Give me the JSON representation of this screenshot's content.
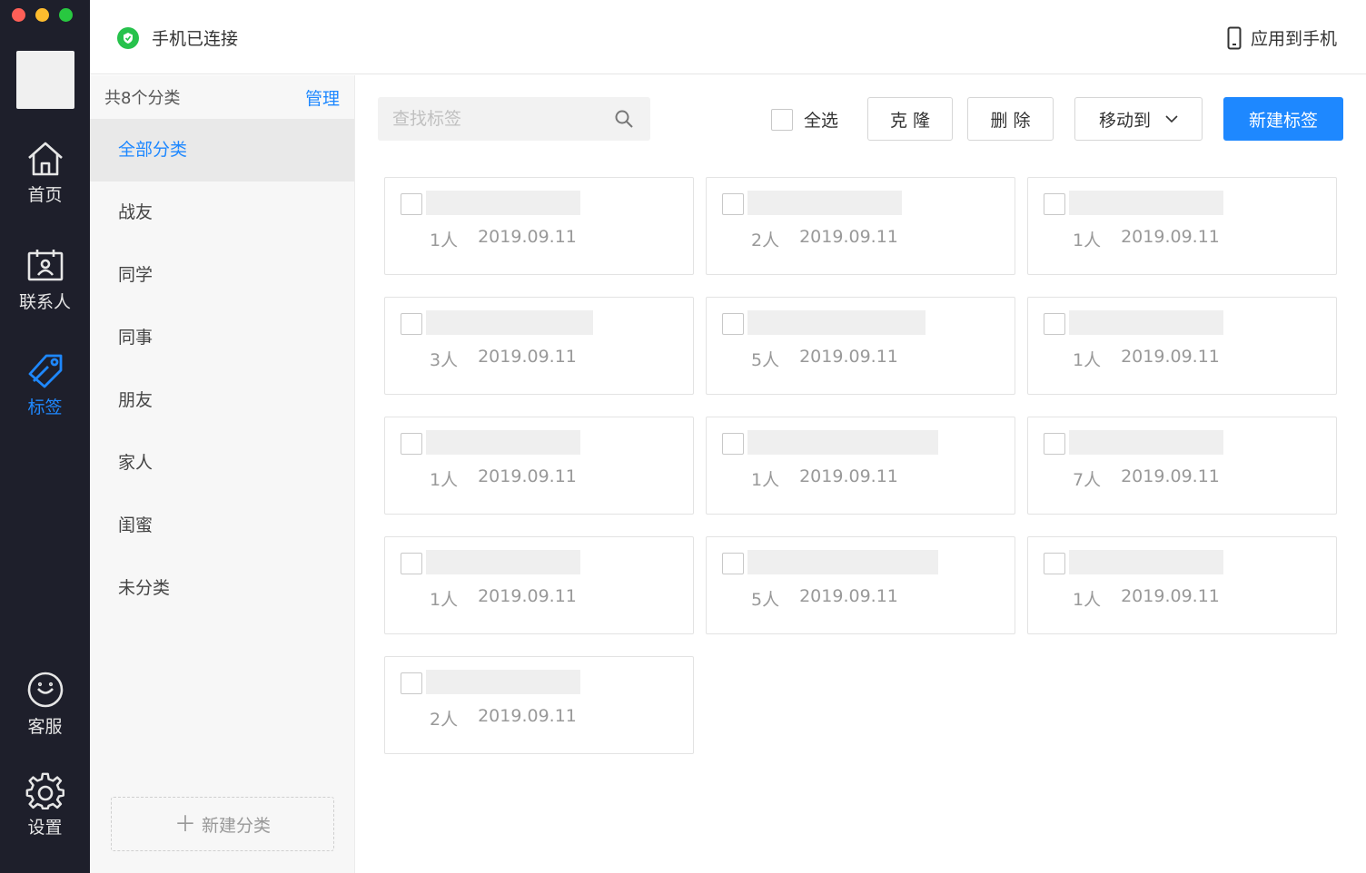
{
  "window": {
    "traffic_colors": [
      "#ff5f57",
      "#febc2e",
      "#28c840"
    ]
  },
  "nav": {
    "items": [
      {
        "label": "首页",
        "icon": "home-icon"
      },
      {
        "label": "联系人",
        "icon": "contacts-icon"
      },
      {
        "label": "标签",
        "icon": "tag-icon",
        "active": true
      },
      {
        "label": "客服",
        "icon": "smiley-icon"
      },
      {
        "label": "设置",
        "icon": "gear-icon"
      }
    ]
  },
  "header": {
    "status": "手机已连接",
    "apply_label": "应用到手机"
  },
  "categories": {
    "count_label": "共8个分类",
    "manage_label": "管理",
    "items": [
      "全部分类",
      "战友",
      "同学",
      "同事",
      "朋友",
      "家人",
      "闺蜜",
      "未分类"
    ],
    "active_index": 0,
    "new_label": "新建分类"
  },
  "toolbar": {
    "search_placeholder": "查找标签",
    "select_all": "全选",
    "clone": "克 隆",
    "delete": "删 除",
    "move_to": "移动到",
    "new_tag": "新建标签"
  },
  "tags": [
    {
      "count": "1人",
      "date": "2019.09.11"
    },
    {
      "count": "2人",
      "date": "2019.09.11"
    },
    {
      "count": "1人",
      "date": "2019.09.11"
    },
    {
      "count": "3人",
      "date": "2019.09.11"
    },
    {
      "count": "5人",
      "date": "2019.09.11"
    },
    {
      "count": "1人",
      "date": "2019.09.11"
    },
    {
      "count": "1人",
      "date": "2019.09.11"
    },
    {
      "count": "1人",
      "date": "2019.09.11"
    },
    {
      "count": "7人",
      "date": "2019.09.11"
    },
    {
      "count": "1人",
      "date": "2019.09.11"
    },
    {
      "count": "5人",
      "date": "2019.09.11"
    },
    {
      "count": "1人",
      "date": "2019.09.11"
    },
    {
      "count": "2人",
      "date": "2019.09.11"
    }
  ],
  "colors": {
    "accent": "#1e88ff",
    "nav_bg": "#1e1f2b",
    "connected": "#27c24c"
  }
}
